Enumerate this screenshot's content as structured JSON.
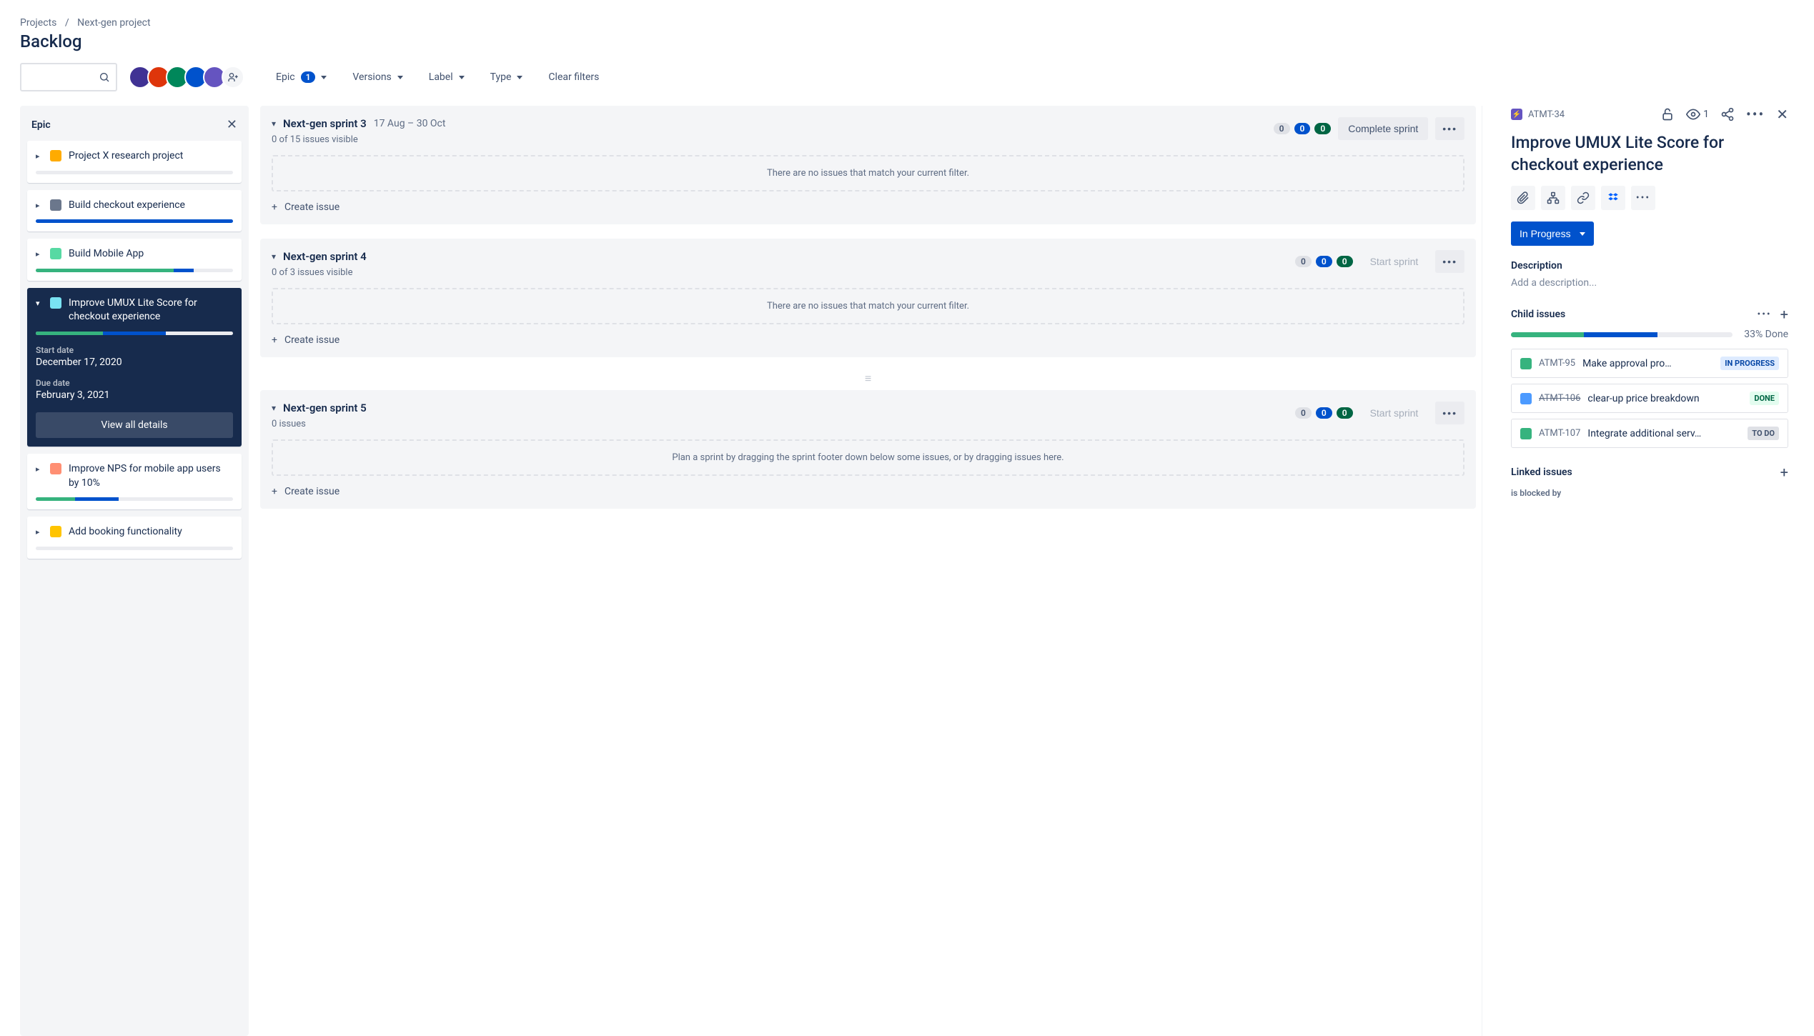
{
  "breadcrumb": {
    "projects": "Projects",
    "project": "Next-gen project"
  },
  "page_title": "Backlog",
  "filters": {
    "epic": "Epic",
    "epic_count": "1",
    "versions": "Versions",
    "label": "Label",
    "type": "Type",
    "clear": "Clear filters"
  },
  "epic_panel": {
    "title": "Epic",
    "items": [
      {
        "name": "Project X research project",
        "swatch": "#FFAB00",
        "g": 0,
        "b": 0,
        "selected": false
      },
      {
        "name": "Build checkout experience",
        "swatch": "#6B778C",
        "g": 0,
        "b": 100,
        "selected": false
      },
      {
        "name": "Build Mobile App",
        "swatch": "#57D9A3",
        "g": 70,
        "b": 10,
        "selected": false
      },
      {
        "name": "Improve UMUX Lite Score for checkout experience",
        "swatch": "#79E2F2",
        "g": 34,
        "b": 32,
        "selected": true,
        "start_label": "Start date",
        "start_value": "December 17, 2020",
        "due_label": "Due date",
        "due_value": "February 3, 2021",
        "view_all": "View all details"
      },
      {
        "name": "Improve NPS for mobile app users by 10%",
        "swatch": "#FF8F73",
        "g": 20,
        "b": 22,
        "selected": false
      },
      {
        "name": "Add booking functionality",
        "swatch": "#FFC400",
        "g": 0,
        "b": 0,
        "selected": false
      }
    ]
  },
  "sprints": [
    {
      "name": "Next-gen sprint 3",
      "dates": "17 Aug – 30 Oct",
      "sub": "0 of 15 issues visible",
      "counts": {
        "todo": "0",
        "prog": "0",
        "done": "0"
      },
      "action": "Complete sprint",
      "action_enabled": true,
      "empty": "There are no issues that match your current filter.",
      "create": "Create issue"
    },
    {
      "name": "Next-gen sprint 4",
      "dates": "",
      "sub": "0 of 3 issues visible",
      "counts": {
        "todo": "0",
        "prog": "0",
        "done": "0"
      },
      "action": "Start sprint",
      "action_enabled": false,
      "empty": "There are no issues that match your current filter.",
      "create": "Create issue"
    },
    {
      "name": "Next-gen sprint 5",
      "dates": "",
      "sub": "0 issues",
      "counts": {
        "todo": "0",
        "prog": "0",
        "done": "0"
      },
      "action": "Start sprint",
      "action_enabled": false,
      "empty": "Plan a sprint by dragging the sprint footer down below some issues, or by dragging issues here.",
      "create": "Create issue"
    }
  ],
  "detail": {
    "key": "ATMT-34",
    "watch_count": "1",
    "title": "Improve UMUX Lite Score for checkout experience",
    "status": "In Progress",
    "description_heading": "Description",
    "description_placeholder": "Add a description...",
    "child_heading": "Child issues",
    "progress_pct_green": 33,
    "progress_pct_blue": 33,
    "progress_label": "33% Done",
    "children": [
      {
        "icon": "story",
        "key": "ATMT-95",
        "struck": false,
        "title": "Make approval pro…",
        "status": "IN PROGRESS",
        "loz": "inprog"
      },
      {
        "icon": "task",
        "key": "ATMT-106",
        "struck": true,
        "title": "clear-up price breakdown",
        "status": "DONE",
        "loz": "done"
      },
      {
        "icon": "story",
        "key": "ATMT-107",
        "struck": false,
        "title": "Integrate additional serv…",
        "status": "TO DO",
        "loz": "todo"
      }
    ],
    "linked_heading": "Linked issues",
    "linked_type": "is blocked by"
  }
}
